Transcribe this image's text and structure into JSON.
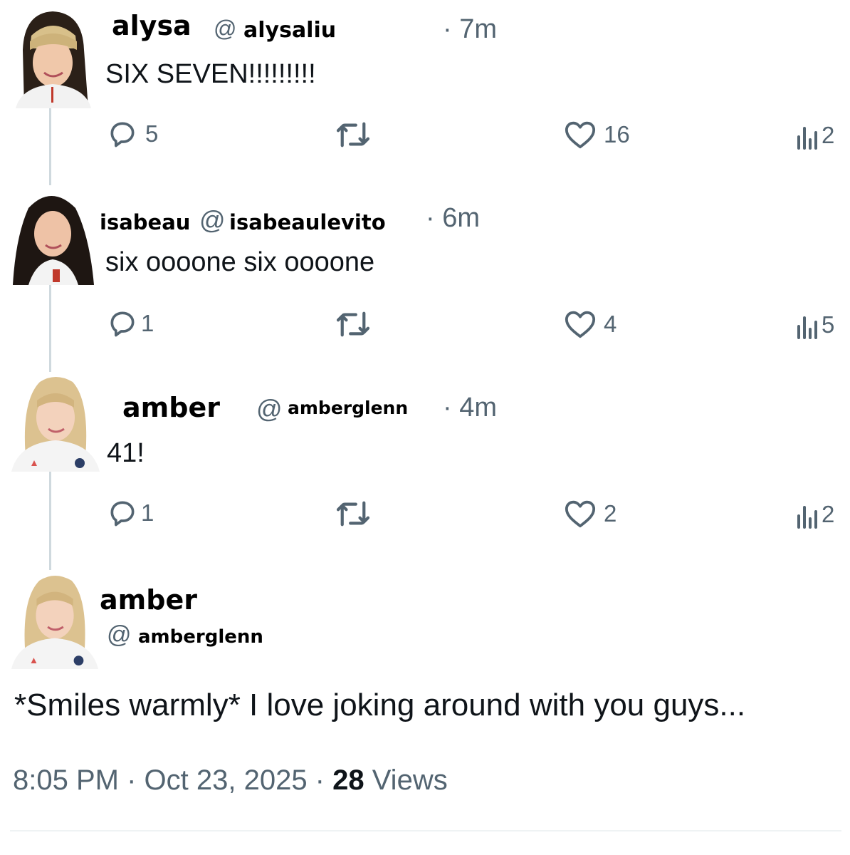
{
  "tweets": [
    {
      "name": "alysa",
      "handle_at": "@",
      "handle": "alysaliu",
      "time": "· 7m",
      "text": "SIX SEVEN!!!!!!!!!",
      "replies": "5",
      "retweets": "",
      "likes": "16",
      "views": "2"
    },
    {
      "name": "isabeau",
      "handle_at": "@",
      "handle": "isabeaulevito",
      "time": "· 6m",
      "text": "six oooone six oooone",
      "replies": "1",
      "retweets": "",
      "likes": "4",
      "views": "5"
    },
    {
      "name": "amber",
      "handle_at": "@",
      "handle": "amberglenn",
      "time": "· 4m",
      "text": "41!",
      "replies": "1",
      "retweets": "",
      "likes": "2",
      "views": "2"
    }
  ],
  "main_tweet": {
    "name": "amber",
    "handle_at": "@",
    "handle": "amberglenn",
    "text": "*Smiles warmly* I love joking around with you guys...",
    "time": "8:05 PM",
    "sep1": " · ",
    "date": "Oct 23, 2025",
    "sep2": " · ",
    "views_count": "28",
    "views_label": " Views"
  },
  "icons": {
    "reply": "reply-icon",
    "retweet": "retweet-icon",
    "like": "heart-icon",
    "views": "views-icon"
  },
  "colors": {
    "text": "#0f1419",
    "muted": "#536471",
    "thread_line": "#cfd9de"
  }
}
